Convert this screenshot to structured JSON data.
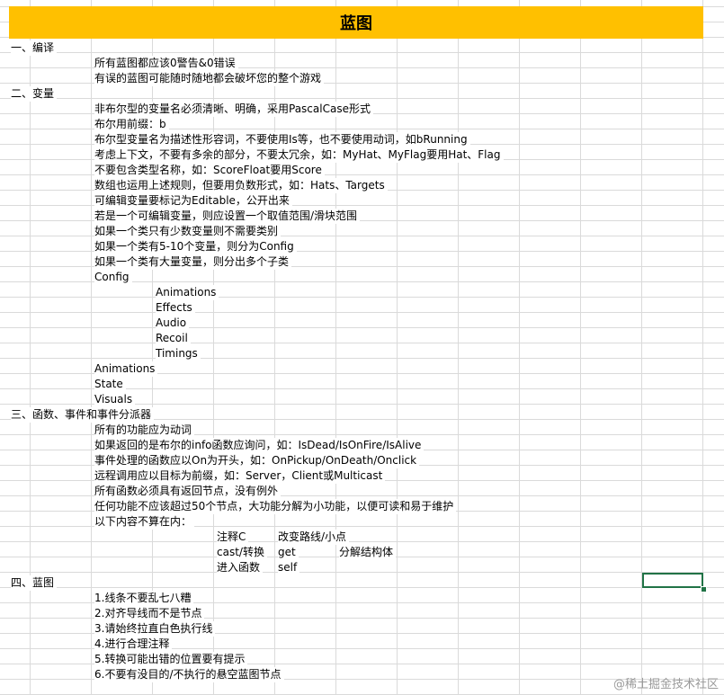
{
  "title": "蓝图",
  "sections": [
    {
      "heading": "一、编译",
      "lines": [
        {
          "indent": 1,
          "text": "所有蓝图都应该0警告&0错误"
        },
        {
          "indent": 1,
          "text": "有误的蓝图可能随时随地都会破坏您的整个游戏"
        }
      ]
    },
    {
      "heading": "二、变量",
      "lines": [
        {
          "indent": 1,
          "text": "非布尔型的变量名必须清晰、明确，采用PascalCase形式"
        },
        {
          "indent": 1,
          "text": "布尔用前缀：b"
        },
        {
          "indent": 1,
          "text": "布尔型变量名为描述性形容词，不要使用Is等，也不要使用动词，如bRunning"
        },
        {
          "indent": 1,
          "text": "考虑上下文，不要有多余的部分，不要太冗余，如：MyHat、MyFlag要用Hat、Flag"
        },
        {
          "indent": 1,
          "text": "不要包含类型名称，如：ScoreFloat要用Score"
        },
        {
          "indent": 1,
          "text": "数组也运用上述规则，但要用负数形式，如：Hats、Targets"
        },
        {
          "indent": 1,
          "text": "可编辑变量要标记为Editable，公开出来"
        },
        {
          "indent": 1,
          "text": "若是一个可编辑变量，则应设置一个取值范围/滑块范围"
        },
        {
          "indent": 1,
          "text": "如果一个类只有少数变量则不需要类别"
        },
        {
          "indent": 1,
          "text": "如果一个类有5-10个变量，则分为Config"
        },
        {
          "indent": 1,
          "text": "如果一个类有大量变量，则分出多个子类"
        },
        {
          "indent": 1,
          "text": "Config"
        },
        {
          "indent": 2,
          "text": "Animations"
        },
        {
          "indent": 2,
          "text": "Effects"
        },
        {
          "indent": 2,
          "text": "Audio"
        },
        {
          "indent": 2,
          "text": "Recoil"
        },
        {
          "indent": 2,
          "text": "Timings"
        },
        {
          "indent": 1,
          "text": "Animations"
        },
        {
          "indent": 1,
          "text": "State"
        },
        {
          "indent": 1,
          "text": "Visuals"
        }
      ]
    },
    {
      "heading": "三、函数、事件和事件分派器",
      "lines": [
        {
          "indent": 1,
          "text": "所有的功能应为动词"
        },
        {
          "indent": 1,
          "text": "如果返回的是布尔的info函数应询问，如：IsDead/IsOnFire/IsAlive"
        },
        {
          "indent": 1,
          "text": "事件处理的函数应以On为开头，如：OnPickup/OnDeath/Onclick"
        },
        {
          "indent": 1,
          "text": "远程调用应以目标为前缀，如：Server，Client或Multicast"
        },
        {
          "indent": 1,
          "text": "所有函数必须具有返回节点，没有例外"
        },
        {
          "indent": 1,
          "text": "任何功能不应该超过50个节点，大功能分解为小功能，以便可读和易于维护"
        },
        {
          "indent": 1,
          "text": "以下内容不算在内："
        }
      ]
    }
  ],
  "exclusion_table": [
    [
      "注释C",
      "改变路线/小点",
      ""
    ],
    [
      "cast/转换",
      "get",
      "分解结构体"
    ],
    [
      "进入函数",
      "self",
      ""
    ]
  ],
  "section4": {
    "heading": "四、蓝图",
    "lines": [
      "1.线条不要乱七八糟",
      "2.对齐导线而不是节点",
      "3.请始终拉直白色执行线",
      "4.进行合理注释",
      "5.转换可能出错的位置要有提示",
      "6.不要有没目的/不执行的悬空蓝图节点"
    ]
  },
  "watermark": "@稀土掘金技术社区",
  "colors": {
    "title_fill": "#ffc000",
    "selection": "#217346",
    "grid": "#dadada"
  }
}
